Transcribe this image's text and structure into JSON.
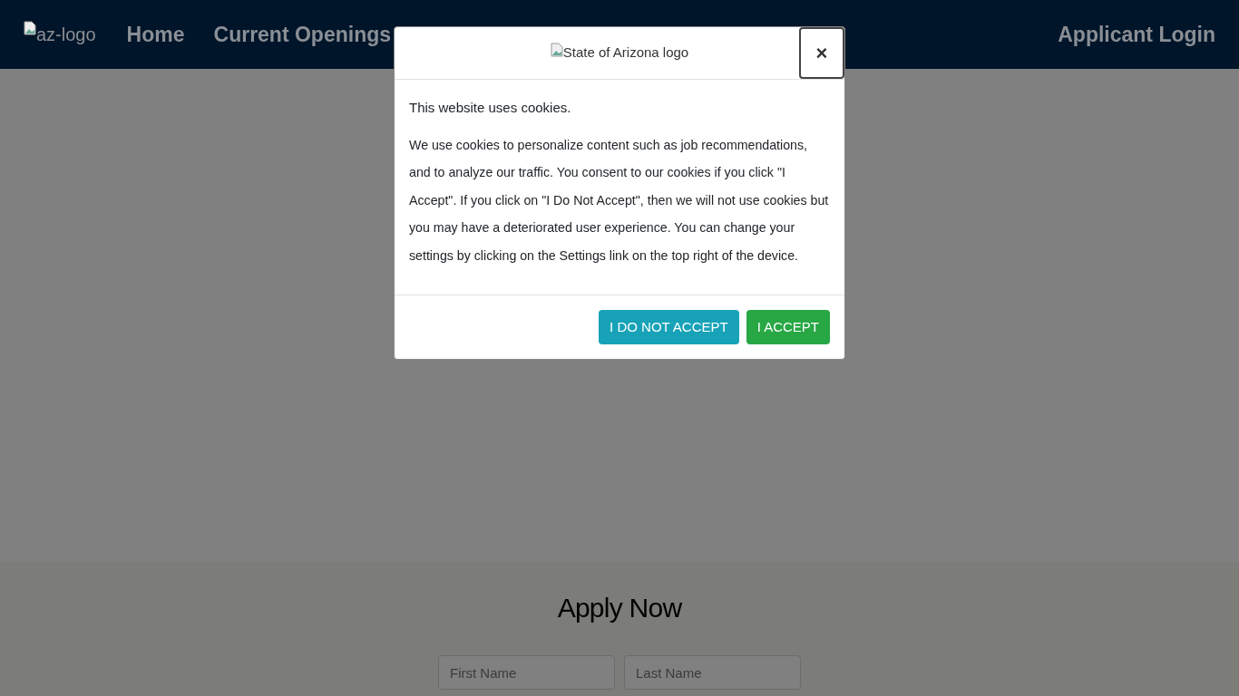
{
  "navbar": {
    "logo_alt": "az-logo",
    "links": [
      {
        "label": "Home"
      },
      {
        "label": "Current Openings"
      }
    ],
    "login": "Applicant Login"
  },
  "apply": {
    "title": "Apply Now",
    "fields": [
      {
        "placeholder": "First Name"
      },
      {
        "placeholder": "Last Name"
      }
    ]
  },
  "modal": {
    "logo_alt": "State of Arizona logo",
    "close": "×",
    "heading": "This website uses cookies.",
    "body": "We use cookies to personalize content such as job recommendations, and to analyze our traffic. You consent to our cookies if you click \"I Accept\". If you click on \"I Do Not Accept\", then we will not use cookies but you may have a deteriorated user experience. You can change your settings by clicking on the Settings link on the top right of the device.",
    "buttons": [
      {
        "label": "I DO NOT ACCEPT",
        "kind": "decline"
      },
      {
        "label": "I ACCEPT",
        "kind": "accept"
      }
    ]
  }
}
